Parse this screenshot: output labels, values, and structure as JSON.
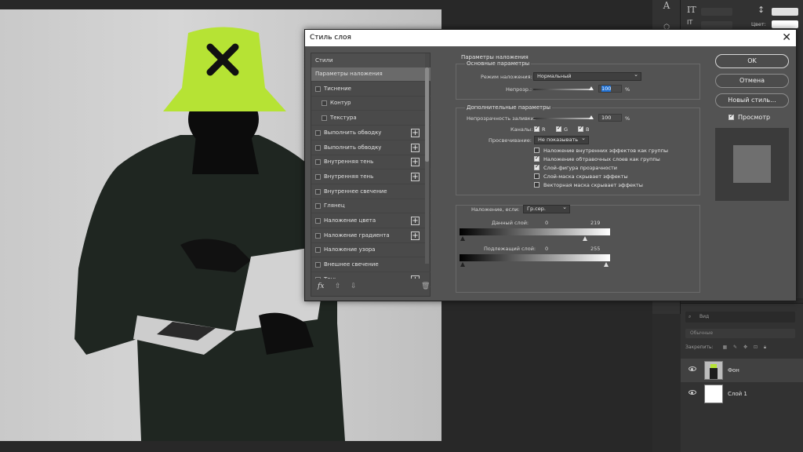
{
  "dialog": {
    "title": "Стиль слоя",
    "close_glyph": "✕",
    "buttons": {
      "ok": "OK",
      "cancel": "Отмена",
      "new_style": "Новый стиль...",
      "preview": "Просмотр"
    }
  },
  "styles": {
    "header": "Стили",
    "items": [
      {
        "label": "Параметры наложения",
        "checkbox": false,
        "plus": false,
        "indent": 0,
        "active": true
      },
      {
        "label": "Тиснение",
        "checkbox": true,
        "plus": false,
        "indent": 0
      },
      {
        "label": "Контур",
        "checkbox": true,
        "plus": false,
        "indent": 1
      },
      {
        "label": "Текстура",
        "checkbox": true,
        "plus": false,
        "indent": 1
      },
      {
        "label": "Выполнить обводку",
        "checkbox": true,
        "plus": true,
        "indent": 0
      },
      {
        "label": "Выполнить обводку",
        "checkbox": true,
        "plus": true,
        "indent": 0
      },
      {
        "label": "Внутренняя тень",
        "checkbox": true,
        "plus": true,
        "indent": 0
      },
      {
        "label": "Внутренняя тень",
        "checkbox": true,
        "plus": true,
        "indent": 0
      },
      {
        "label": "Внутреннее свечение",
        "checkbox": true,
        "plus": false,
        "indent": 0
      },
      {
        "label": "Глянец",
        "checkbox": true,
        "plus": false,
        "indent": 0
      },
      {
        "label": "Наложение цвета",
        "checkbox": true,
        "plus": true,
        "indent": 0
      },
      {
        "label": "Наложение градиента",
        "checkbox": true,
        "plus": true,
        "indent": 0
      },
      {
        "label": "Наложение узора",
        "checkbox": true,
        "plus": false,
        "indent": 0
      },
      {
        "label": "Внешнее свечение",
        "checkbox": true,
        "plus": false,
        "indent": 0
      },
      {
        "label": "Тень",
        "checkbox": true,
        "plus": true,
        "indent": 0
      }
    ],
    "footer_fx": "fx"
  },
  "blending": {
    "title": "Параметры наложения",
    "basic": {
      "title": "Основные параметры",
      "mode_label": "Режим наложения:",
      "mode_value": "Нормальный",
      "opacity_label": "Непрозр.:",
      "opacity_value": "100",
      "opacity_unit": "%",
      "opacity_level": 1.0
    },
    "advanced": {
      "title": "Дополнительные параметры",
      "fill_label": "Непрозрачность заливки:",
      "fill_value": "100",
      "fill_unit": "%",
      "fill_level": 1.0,
      "channels_label": "Каналы:",
      "channel_r": "R",
      "channel_g": "G",
      "channel_b": "B",
      "knockout_label": "Просвечивание:",
      "knockout_value": "Не показывать",
      "options": [
        {
          "label": "Наложение внутренних эффектов как группы",
          "checked": false
        },
        {
          "label": "Наложение обтравочных слоев как группы",
          "checked": true
        },
        {
          "label": "Слой-фигура прозрачности",
          "checked": true
        },
        {
          "label": "Слой-маска скрывает эффекты",
          "checked": false
        },
        {
          "label": "Векторная маска скрывает эффекты",
          "checked": false
        }
      ]
    },
    "blend_if": {
      "label": "Наложение, если:",
      "value": "Гр.сер.",
      "this_layer_label": "Данный слой:",
      "this_layer_min": "0",
      "this_layer_max": "219",
      "underlying_label": "Подлежащий слой:",
      "underlying_min": "0",
      "underlying_max": "255"
    }
  },
  "layers": {
    "search_placeholder": "Вид",
    "blend_mode": "Обычные",
    "lock_label": "Закрепить:",
    "items": [
      {
        "name": "Фон",
        "active": true
      },
      {
        "name": "Слой 1",
        "active": false
      }
    ]
  },
  "properties": {
    "color_label": "Цвет:"
  },
  "colors": {
    "hat": "#b6e334",
    "dialog_bg": "#535353",
    "accent_selection": "#1f6fd0"
  }
}
